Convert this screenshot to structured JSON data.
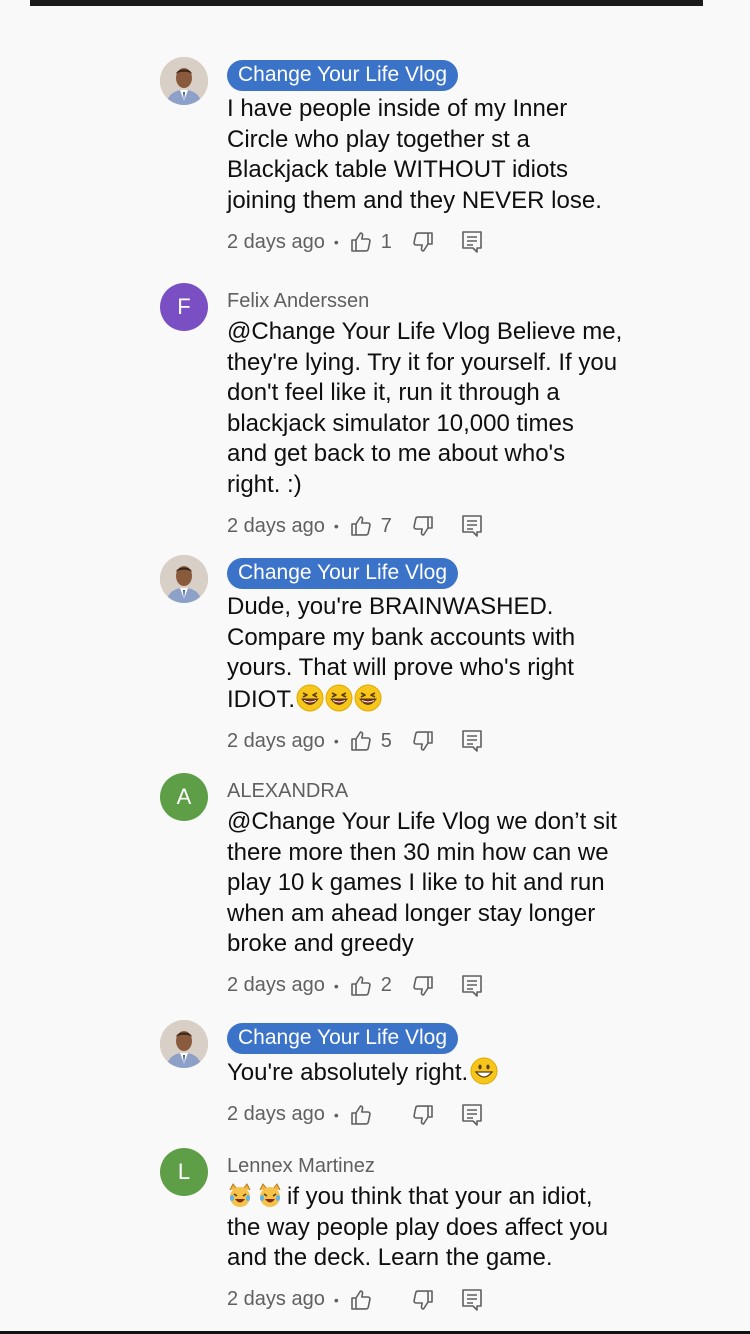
{
  "comments": [
    {
      "author": "Change Your Life Vlog",
      "author_style": "chip",
      "avatar": {
        "type": "photo"
      },
      "text": "I have people inside of my Inner\nCircle who play together st a\nBlackjack table WITHOUT idiots\njoining them and they NEVER lose.",
      "emojis": [],
      "time": "2 days ago",
      "likes": "1"
    },
    {
      "author": "Felix Anderssen",
      "author_style": "plain",
      "avatar": {
        "type": "letter",
        "letter": "F",
        "color": "#7b4fc4"
      },
      "text": "@Change Your Life Vlog Believe me,\nthey're lying. Try it for yourself. If you\ndon't feel like it, run it through a\nblackjack simulator 10,000 times\nand get back to me about who's\nright. :)",
      "emojis": [],
      "time": "2 days ago",
      "likes": "7"
    },
    {
      "author": "Change Your Life Vlog",
      "author_style": "chip",
      "avatar": {
        "type": "photo"
      },
      "text": "Dude, you're BRAINWASHED.\nCompare my bank accounts with\nyours. That will prove who's right\nIDIOT.",
      "emojis": [
        "laughing",
        "laughing",
        "laughing"
      ],
      "time": "2 days ago",
      "likes": "5"
    },
    {
      "author": "ALEXANDRA",
      "author_style": "plain",
      "avatar": {
        "type": "letter",
        "letter": "A",
        "color": "#5d9e46"
      },
      "text": "@Change Your Life Vlog we don’t sit\nthere more then 30 min how can we\nplay 10 k games I like to hit and run\nwhen am ahead longer stay longer\nbroke and greedy",
      "emojis": [],
      "time": "2 days ago",
      "likes": "2"
    },
    {
      "author": "Change Your Life Vlog",
      "author_style": "chip",
      "avatar": {
        "type": "photo"
      },
      "text": "You're absolutely right.",
      "emojis": [
        "grinning"
      ],
      "time": "2 days ago",
      "likes": ""
    },
    {
      "author": "Lennex Martinez",
      "author_style": "plain",
      "avatar": {
        "type": "letter",
        "letter": "L",
        "color": "#5d9e46"
      },
      "text": "if you think that your an idiot,\nthe way people play does affect you\nand the deck. Learn the game.",
      "emojis_prefix": [
        "crying-laughing-cat",
        "crying-laughing-cat"
      ],
      "emojis": [],
      "time": "2 days ago",
      "likes": ""
    }
  ],
  "separator": "•"
}
